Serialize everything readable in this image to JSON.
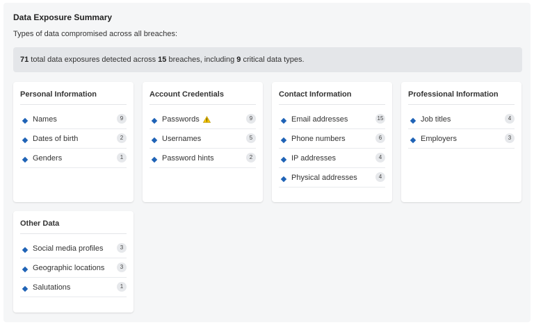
{
  "title": "Data Exposure Summary",
  "subtitle": "Types of data compromised across all breaches:",
  "summary": {
    "total": "71",
    "text1": " total data exposures detected across ",
    "breaches": "15",
    "text2": " breaches, including ",
    "critical": "9",
    "text3": " critical data types."
  },
  "colors": {
    "accent": "#1f63b6",
    "warning": "#f2c200"
  },
  "categories": [
    {
      "title": "Personal Information",
      "items": [
        {
          "label": "Names",
          "count": "9"
        },
        {
          "label": "Dates of birth",
          "count": "2"
        },
        {
          "label": "Genders",
          "count": "1"
        }
      ]
    },
    {
      "title": "Account Credentials",
      "items": [
        {
          "label": "Passwords",
          "count": "9",
          "warning_icon": "warning-triangle-icon"
        },
        {
          "label": "Usernames",
          "count": "5"
        },
        {
          "label": "Password hints",
          "count": "2"
        }
      ]
    },
    {
      "title": "Contact Information",
      "items": [
        {
          "label": "Email addresses",
          "count": "15"
        },
        {
          "label": "Phone numbers",
          "count": "6"
        },
        {
          "label": "IP addresses",
          "count": "4"
        },
        {
          "label": "Physical addresses",
          "count": "4"
        }
      ]
    },
    {
      "title": "Professional Information",
      "items": [
        {
          "label": "Job titles",
          "count": "4"
        },
        {
          "label": "Employers",
          "count": "3"
        }
      ]
    },
    {
      "title": "Other Data",
      "items": [
        {
          "label": "Social media profiles",
          "count": "3"
        },
        {
          "label": "Geographic locations",
          "count": "3"
        },
        {
          "label": "Salutations",
          "count": "1"
        }
      ]
    }
  ]
}
